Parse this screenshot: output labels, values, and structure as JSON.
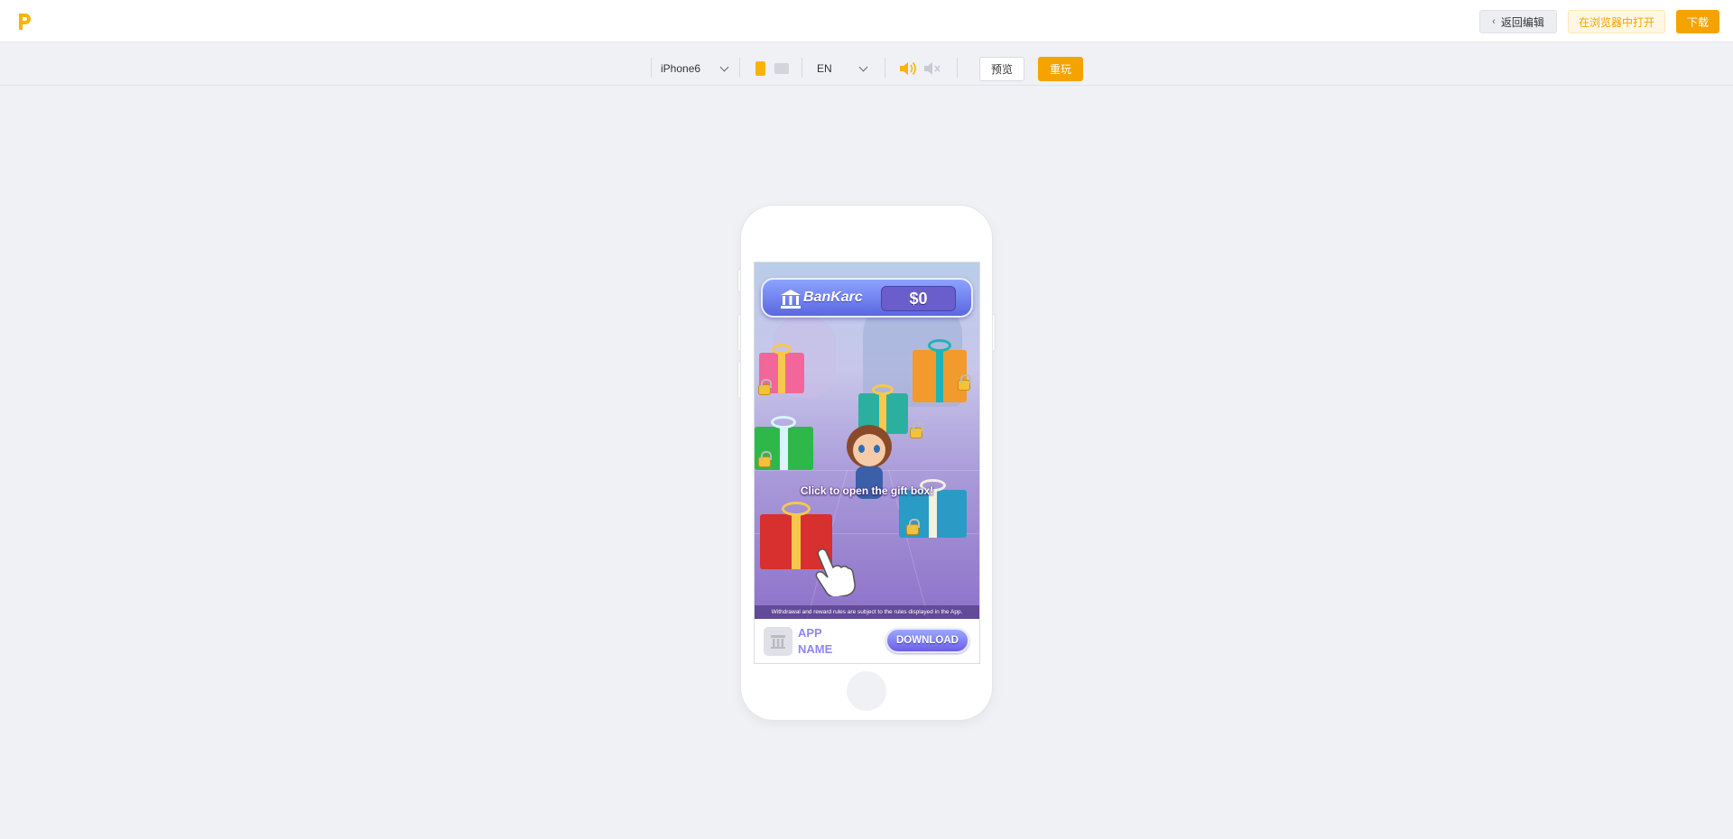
{
  "header": {
    "logo_icon": "p-logo-icon",
    "back_button_label": "返回编辑",
    "open_in_browser_label": "在浏览器中打开",
    "download_label": "下载"
  },
  "toolbar": {
    "device_select": {
      "selected": "iPhone6"
    },
    "orientation": {
      "selected": "portrait",
      "options": [
        "portrait",
        "landscape"
      ]
    },
    "language_select": {
      "selected": "EN"
    },
    "sound": {
      "state": "on"
    },
    "preview_label": "预览",
    "replay_label": "重玩"
  },
  "ad": {
    "bank_name": "BanKarc",
    "balance": "$0",
    "instruction": "Click to open the gift box!",
    "disclaimer": "Withdrawal and reward rules are subject to the rules displayed in the App.",
    "app_name": "APP NAME",
    "cta_label": "DOWNLOAD"
  },
  "colors": {
    "accent": "#f5a300",
    "accent_light_bg": "#fff7e3",
    "cta_purple": "#6b5fe6",
    "app_name_color": "#8f86ef"
  }
}
